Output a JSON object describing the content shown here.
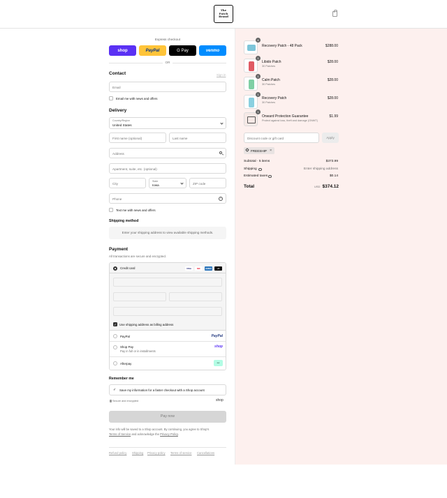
{
  "header": {
    "logo_lines": [
      "The",
      "Patch",
      "Brand"
    ],
    "bag_icon": "shopping-bag-icon"
  },
  "express": {
    "label": "Express checkout",
    "buttons": [
      {
        "id": "shop",
        "label": "shop",
        "color": "#5a31f4"
      },
      {
        "id": "paypal",
        "label": "PayPal",
        "color": "#ffc439"
      },
      {
        "id": "gpay",
        "label": "G Pay",
        "color": "#000000"
      },
      {
        "id": "venmo",
        "label": "venmo",
        "color": "#008cff"
      }
    ],
    "or_text": "OR"
  },
  "contact": {
    "heading": "Contact",
    "sign_in": "Sign in",
    "email_placeholder": "Email",
    "news_label": "Email me with news and offers"
  },
  "delivery": {
    "heading": "Delivery",
    "country_label": "Country/Region",
    "country_value": "United States",
    "first_name": "First name (optional)",
    "last_name": "Last name",
    "address": "Address",
    "apartment": "Apartment, suite, etc. (optional)",
    "city": "City",
    "state_label": "State",
    "state_value": "Iowa",
    "zip": "ZIP code",
    "phone": "Phone",
    "text_label": "Text me with news and offers"
  },
  "shipping": {
    "heading": "Shipping method",
    "message": "Enter your shipping address to view available shipping methods."
  },
  "payment": {
    "heading": "Payment",
    "subtitle": "All transactions are secure and encrypted.",
    "credit_card": "Credit card",
    "card_logos": [
      "VISA",
      "MC",
      "AMEX",
      "+5"
    ],
    "billing_label": "Use shipping address as billing address",
    "paypal": "PayPal",
    "paypal_logo": "PayPal",
    "shop_pay": "Shop Pay",
    "shop_pay_sub": "Pay in full or in installments",
    "shop_logo": "shop",
    "afterpay": "Afterpay",
    "afterpay_logo": "↔"
  },
  "remember": {
    "heading": "Remember me",
    "save_label": "Save my information for a faster checkout with a Shop account",
    "secure": "Secure and encrypted",
    "shop_logo": "shop"
  },
  "pay_now": "Pay now",
  "legal": {
    "line1": "Your info will be saved to a Shop account. By continuing, you agree to Shop's",
    "terms": "Terms of Service",
    "middle": " and acknowledge the ",
    "privacy": "Privacy Policy",
    "end": "."
  },
  "footer_links": [
    "Refund policy",
    "Shipping",
    "Privacy policy",
    "Terms of service",
    "Cancellations"
  ],
  "cart": {
    "items": [
      {
        "qty": "4",
        "name": "Recovery Patch - 48 Pack",
        "sub": "",
        "price": "$288.00",
        "color": "#7cc5d9"
      },
      {
        "qty": "1",
        "name": "Libido Patch",
        "sub": "30 Patches",
        "price": "$28.00",
        "color": "#e05a63"
      },
      {
        "qty": "1",
        "name": "Calm Patch",
        "sub": "30 Patches",
        "price": "$28.00",
        "color": "#7fcfa4"
      },
      {
        "qty": "1",
        "name": "Recovery Patch",
        "sub": "30 Patches",
        "price": "$28.00",
        "color": "#8ad0e0"
      },
      {
        "qty": "1",
        "name": "Onward Protection Guarantee",
        "sub": "Protect against loss, theft and damage (ONWT)",
        "price": "$1.99",
        "color": "#555555"
      }
    ],
    "discount_placeholder": "Discount code or gift card",
    "apply": "Apply",
    "chip": "FREESHIP",
    "subtotal_label": "Subtotal · 5 items",
    "subtotal": "$373.99",
    "shipping_label": "Shipping",
    "shipping_value": "Enter shipping address",
    "taxes_label": "Estimated taxes",
    "taxes": "$0.14",
    "total_label": "Total",
    "currency": "USD",
    "total": "$374.12"
  }
}
